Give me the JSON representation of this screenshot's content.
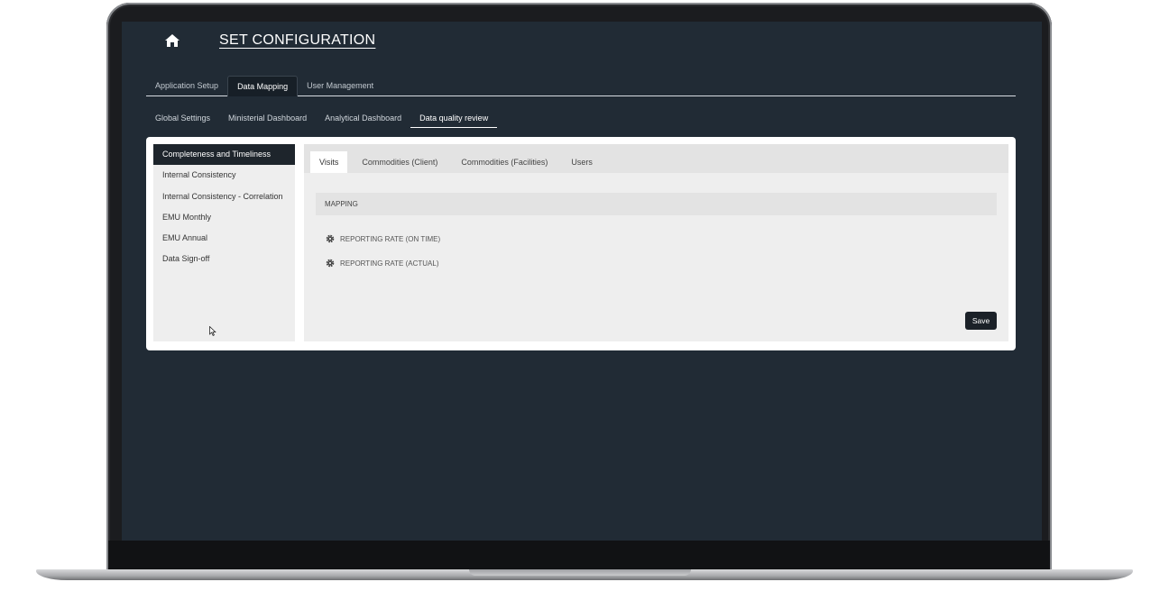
{
  "header": {
    "title": "SET CONFIGURATION",
    "home_icon": "home-icon"
  },
  "main_tabs": [
    {
      "label": "Application Setup",
      "active": false
    },
    {
      "label": "Data Mapping",
      "active": true
    },
    {
      "label": "User Management",
      "active": false
    }
  ],
  "sub_tabs": [
    {
      "label": "Global Settings",
      "active": false
    },
    {
      "label": "Ministerial Dashboard",
      "active": false
    },
    {
      "label": "Analytical Dashboard",
      "active": false
    },
    {
      "label": "Data quality review",
      "active": true
    }
  ],
  "side_menu": [
    {
      "label": "Completeness and Timeliness",
      "active": true
    },
    {
      "label": "Internal Consistency",
      "active": false
    },
    {
      "label": "Internal Consistency - Correlation",
      "active": false
    },
    {
      "label": "EMU Monthly",
      "active": false
    },
    {
      "label": "EMU Annual",
      "active": false
    },
    {
      "label": "Data Sign-off",
      "active": false
    }
  ],
  "inner_tabs": [
    {
      "label": "Visits",
      "active": true
    },
    {
      "label": "Commodities (Client)",
      "active": false
    },
    {
      "label": "Commodities (Facilities)",
      "active": false
    },
    {
      "label": "Users",
      "active": false
    }
  ],
  "mapping": {
    "heading": "MAPPING",
    "rows": [
      {
        "label": "REPORTING RATE (ON TIME)",
        "icon": "gear-icon"
      },
      {
        "label": "REPORTING RATE (ACTUAL)",
        "icon": "gear-icon"
      }
    ]
  },
  "actions": {
    "save_label": "Save"
  },
  "colors": {
    "app_background": "#212b35",
    "accent_dark": "#1e252c",
    "panel": "#ffffff"
  }
}
